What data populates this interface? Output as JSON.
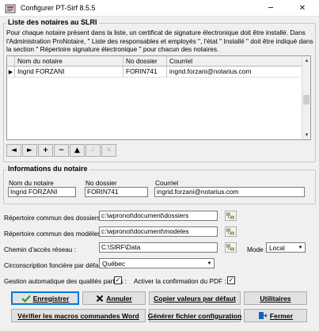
{
  "window": {
    "title": "Configurer PT-Sirf 8.5.5",
    "minimize": "─",
    "close": "✕"
  },
  "notaries_group": {
    "title": "Liste des notaires au SLRI",
    "description": "Pour chaque notaire présent dans la liste, un certificat de signature électronique doit être installé. Dans l'Administration ProNotaire, \" Liste des responsables et employés \", l'état \" Installé \" doit être indiqué dans la section \" Répertoire signature électronique \" pour chacun des notaires.",
    "columns": [
      "Nom du notaire",
      "No dossier",
      "Courriel"
    ],
    "rows": [
      {
        "name": "Ingrid FORZANI",
        "dossier": "FORIN741",
        "email": "ingrid.forzani@notarius.com"
      }
    ]
  },
  "navigator": [
    "◄",
    "►",
    "+",
    "−",
    "▲",
    "✓",
    "✕"
  ],
  "notary_info": {
    "title": "Informations du notaire",
    "name_label": "Nom du notaire",
    "name_value": "Ingrid FORZANI",
    "dossier_label": "No dossier",
    "dossier_value": "FORIN741",
    "email_label": "Courriel",
    "email_value": "ingrid.forzani@notarius.com"
  },
  "paths": {
    "folders_label": "Répertoire commun des dossiers :",
    "folders_value": "c:\\wpronot\\document\\dossiers",
    "models_label": "Répertoire commun des modèles :",
    "models_value": "c:\\wpronot\\document\\modeles",
    "network_label": "Chemin d'accès réseau :",
    "network_value": "C:\\SIRF\\Data",
    "mode_label": "Mode :",
    "mode_value": "Local",
    "circ_label": "Circonscription foncière par défaut :",
    "circ_value": "Québec"
  },
  "options": {
    "auto_quality_label": "Gestion automatique des qualités parties :",
    "auto_quality_checked": true,
    "pdf_confirm_label": "Activer la confirmation du PDF :",
    "pdf_confirm_checked": true,
    "check_mark": "✓"
  },
  "buttons": {
    "save": "Enregistrer",
    "cancel": "Annuler",
    "copy_defaults": "Copier valeurs par défaut",
    "utilities": "Utilitaires",
    "verify_macros": "Vérifier les macros commandes Word",
    "gen_config": "Générer fichier configuration",
    "close": "Fermer"
  },
  "colors": {
    "accent": "#0078d7",
    "save_icon": "#3a9a2a",
    "cancel_icon": "#111111",
    "close_icon": "#1560b7"
  }
}
